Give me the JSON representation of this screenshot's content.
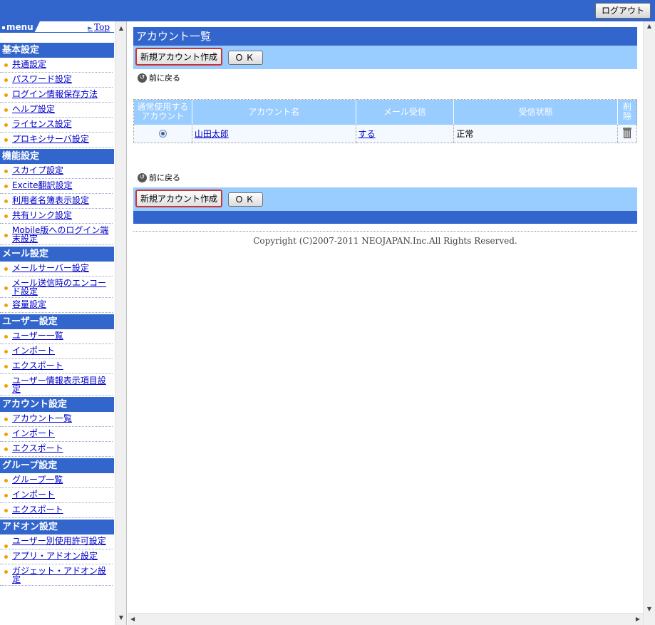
{
  "header": {
    "logout_label": "ログアウト"
  },
  "sidebar": {
    "menu_label": "menu",
    "top_link": "Top",
    "sections": [
      {
        "title": "基本設定",
        "items": [
          "共通設定",
          "パスワード設定",
          "ログイン情報保存方法",
          "ヘルプ設定",
          "ライセンス設定",
          "プロキシサーバ設定"
        ]
      },
      {
        "title": "機能設定",
        "items": [
          "スカイプ設定",
          "Excite翻訳設定",
          "利用者名簿表示設定",
          "共有リンク設定",
          "Mobile版へのログイン端末設定"
        ]
      },
      {
        "title": "メール設定",
        "items": [
          "メールサーバー設定",
          "メール送信時のエンコード設定",
          "容量設定"
        ]
      },
      {
        "title": "ユーザー設定",
        "items": [
          "ユーザー一覧",
          "インポート",
          "エクスポート",
          "ユーザー情報表示項目設定"
        ]
      },
      {
        "title": "アカウント設定",
        "items": [
          "アカウント一覧",
          "インポート",
          "エクスポート"
        ]
      },
      {
        "title": "グループ設定",
        "items": [
          "グループ一覧",
          "インポート",
          "エクスポート"
        ]
      },
      {
        "title": "アドオン設定",
        "items": [
          "ユーザー別使用許可設定",
          "アプリ・アドオン設定",
          "ガジェット・アドオン設定"
        ]
      }
    ]
  },
  "main": {
    "title": "アカウント一覧",
    "new_account_label": "新規アカウント作成",
    "ok_label": "ＯＫ",
    "back_label": "前に戻る",
    "table": {
      "headers": [
        "通常使用するアカウント",
        "アカウント名",
        "メール受信",
        "受信状態",
        "削除"
      ],
      "rows": [
        {
          "name": "山田太郎",
          "mail_receive": "する",
          "status": "正常"
        }
      ]
    },
    "copyright": "Copyright (C)2007-2011 NEOJAPAN.Inc.All Rights Reserved."
  }
}
